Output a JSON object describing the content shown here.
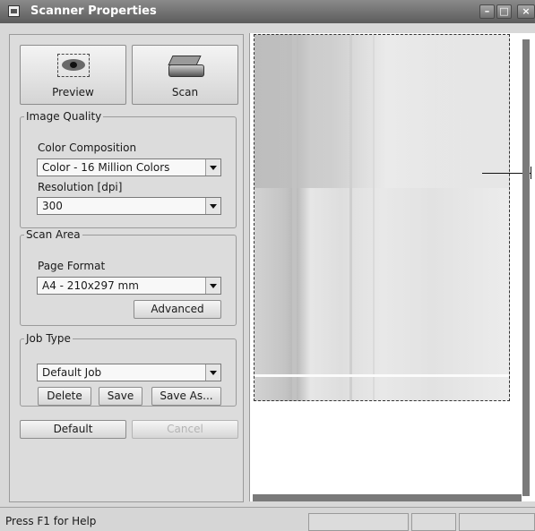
{
  "window": {
    "title": "Scanner Properties"
  },
  "toolbar": {
    "preview_label": "Preview",
    "scan_label": "Scan"
  },
  "image_quality": {
    "legend": "Image Quality",
    "color_composition_label": "Color Composition",
    "color_composition_value": "Color - 16 Million Colors",
    "resolution_label": "Resolution [dpi]",
    "resolution_value": "300"
  },
  "scan_area": {
    "legend": "Scan Area",
    "page_format_label": "Page Format",
    "page_format_value": "A4 - 210x297 mm",
    "advanced_label": "Advanced"
  },
  "job_type": {
    "legend": "Job Type",
    "value": "Default Job",
    "delete_label": "Delete",
    "save_label": "Save",
    "save_as_label": "Save As..."
  },
  "actions": {
    "default_label": "Default",
    "cancel_label": "Cancel"
  },
  "status": {
    "help_text": "Press F1 for Help"
  }
}
